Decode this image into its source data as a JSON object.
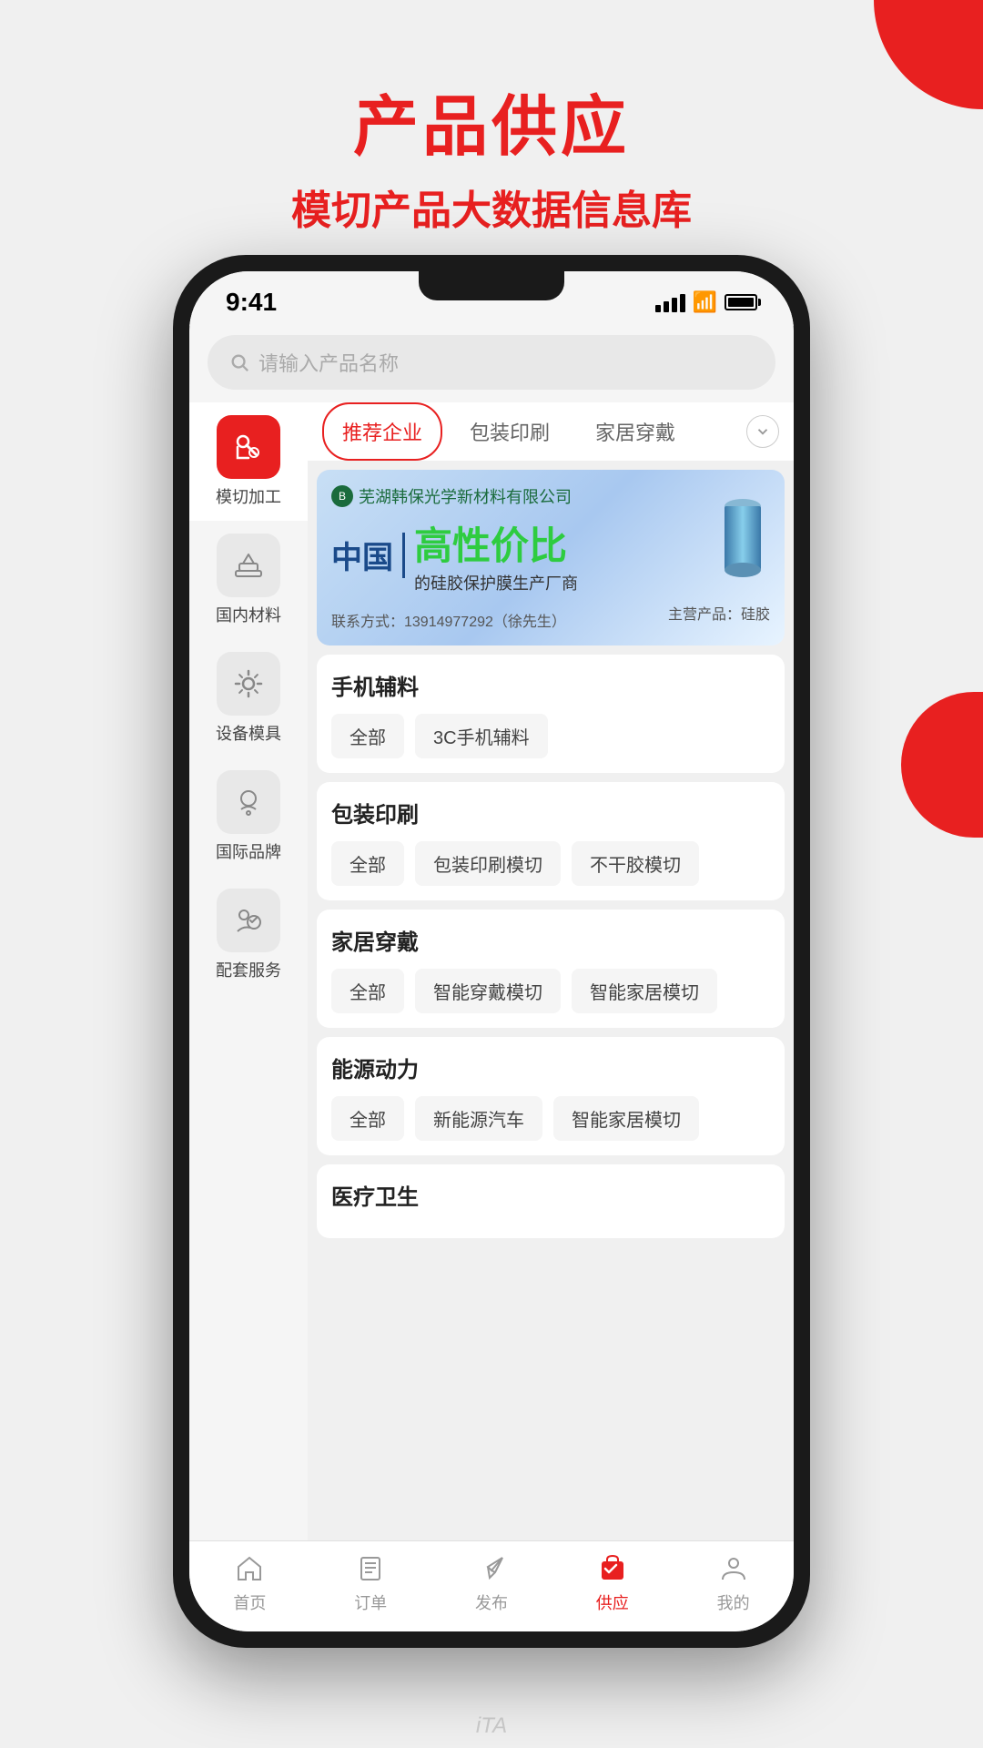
{
  "page": {
    "title1": "产品供应",
    "title2": "模切产品大数据信息库"
  },
  "status_bar": {
    "time": "9:41"
  },
  "search": {
    "placeholder": "请输入产品名称"
  },
  "tabs": [
    {
      "label": "推荐企业",
      "active": true
    },
    {
      "label": "包装印刷",
      "active": false
    },
    {
      "label": "家居穿戴",
      "active": false
    }
  ],
  "sidebar": {
    "items": [
      {
        "label": "模切加工",
        "active": true,
        "icon": "wrench"
      },
      {
        "label": "国内材料",
        "active": false,
        "icon": "material"
      },
      {
        "label": "设备模具",
        "active": false,
        "icon": "gear"
      },
      {
        "label": "国际品牌",
        "active": false,
        "icon": "brand"
      },
      {
        "label": "配套服务",
        "active": false,
        "icon": "service"
      }
    ]
  },
  "banner": {
    "company": "芜湖韩保光学新材料有限公司",
    "china_text": "中国",
    "highlight": "高性价比",
    "subtitle": "的硅胶保护膜生产厂商",
    "contact": "联系方式：13914977292（徐先生）",
    "product": "主营产品：硅胶"
  },
  "categories": [
    {
      "title": "手机辅料",
      "tags": [
        "全部",
        "3C手机辅料"
      ]
    },
    {
      "title": "包装印刷",
      "tags": [
        "全部",
        "包装印刷模切",
        "不干胶模切"
      ]
    },
    {
      "title": "家居穿戴",
      "tags": [
        "全部",
        "智能穿戴模切",
        "智能家居模切"
      ]
    },
    {
      "title": "能源动力",
      "tags": [
        "全部",
        "新能源汽车",
        "智能家居模切"
      ]
    },
    {
      "title": "医疗卫生",
      "tags": []
    }
  ],
  "bottom_nav": [
    {
      "label": "首页",
      "active": false
    },
    {
      "label": "订单",
      "active": false
    },
    {
      "label": "发布",
      "active": false
    },
    {
      "label": "供应",
      "active": true
    },
    {
      "label": "我的",
      "active": false
    }
  ],
  "watermark": "iTA"
}
